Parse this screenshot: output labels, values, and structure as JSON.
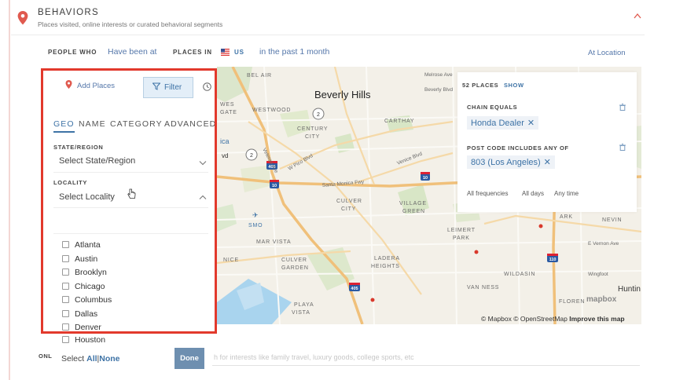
{
  "section": {
    "title": "BEHAVIORS",
    "subtitle": "Places visited, online interests or curated behavioral segments"
  },
  "criteria": {
    "people_who": "PEOPLE WHO",
    "have_been_at": "Have been at",
    "places_in": "PLACES IN",
    "country": "US",
    "timeframe": "in the past 1 month",
    "at_location": "At Location"
  },
  "panel": {
    "add_places": "Add Places",
    "filter": "Filter",
    "tabs": [
      "GEO",
      "NAME",
      "CATEGORY",
      "ADVANCED"
    ],
    "state_label": "STATE/REGION",
    "state_value": "Select State/Region",
    "locality_label": "LOCALITY",
    "locality_value": "Select Locality",
    "cities": [
      "Atlanta",
      "Austin",
      "Brooklyn",
      "Chicago",
      "Columbus",
      "Dallas",
      "Denver",
      "Houston"
    ]
  },
  "places": {
    "count": "52 PLACES",
    "show": "SHOW",
    "cond1_label": "CHAIN EQUALS",
    "cond1_value": "Honda Dealer",
    "cond2_label": "POST CODE INCLUDES ANY OF",
    "cond2_value": "803 (Los Angeles)",
    "freq": "All frequencies",
    "days": "All days",
    "time": "Any time"
  },
  "map": {
    "city_big": "Beverly Hills",
    "labels": [
      "BEL AIR",
      "Melrose Ave",
      "Beverly Blvd",
      "WESTWOOD",
      "CENTURY",
      "CITY",
      "CARTHAY",
      "Veteran Ave",
      "W Pico Blvd",
      "Venice Blvd",
      "Santa Monica Fwy",
      "CULVER",
      "CITY",
      "VILLAGE",
      "GREEN",
      "SMO",
      "MAR VISTA",
      "CULVER",
      "GARDEN",
      "LADERA",
      "HEIGHTS",
      "NICE",
      "PLAYA",
      "VISTA",
      "LEIMERT",
      "PARK",
      "ARK",
      "NEVIN",
      "E Vernon Ave",
      "WILDASIN",
      "Wingfoot",
      "VAN NESS",
      "Huntin",
      "FLOREN",
      "WES",
      "GATE",
      "vd",
      "ica"
    ],
    "shields": [
      "405",
      "10",
      "10",
      "110",
      "405"
    ],
    "circles": [
      "2",
      "2"
    ],
    "attribution": "© Mapbox © OpenStreetMap",
    "improve": "Improve this map",
    "mapbox": "mapbox"
  },
  "footer": {
    "onl": "ONL",
    "select": "Select",
    "all": "All",
    "separator": "|",
    "none": "None",
    "done": "Done",
    "search_placeholder": "h for interests like family travel, luxury goods, college sports, etc"
  },
  "colors": {
    "accent": "#3e73a6",
    "highlight_border": "#e2392c",
    "pin": "#e05a4f"
  }
}
